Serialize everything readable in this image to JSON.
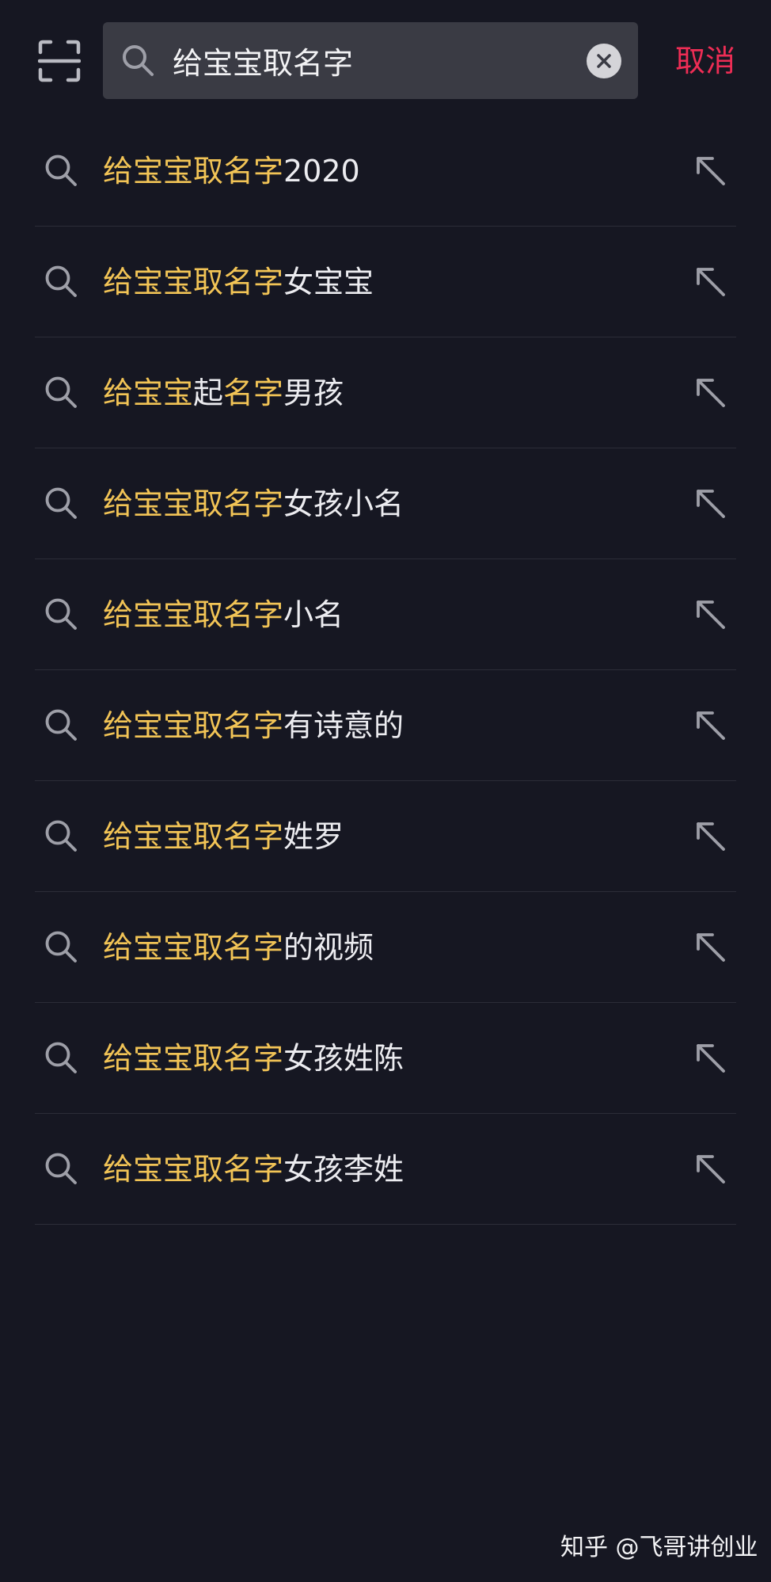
{
  "search": {
    "value": "给宝宝取名字",
    "cancel_label": "取消"
  },
  "icons": {
    "scan": "scan-icon",
    "search": "search-icon",
    "clear": "clear-icon",
    "fill": "arrow-up-left-icon"
  },
  "colors": {
    "background": "#161722",
    "search_box": "#3a3b44",
    "highlight": "#f2c456",
    "cancel": "#ee2d55",
    "divider": "#2c2d38"
  },
  "suggestions": [
    {
      "highlight": "给宝宝取名字",
      "rest": "2020"
    },
    {
      "highlight": "给宝宝取名字",
      "rest": "女宝宝"
    },
    {
      "parts": [
        {
          "text": "给宝宝",
          "hl": true
        },
        {
          "text": "起",
          "hl": false
        },
        {
          "text": "名字",
          "hl": true
        },
        {
          "text": "男孩",
          "hl": false
        }
      ]
    },
    {
      "highlight": "给宝宝取名字",
      "rest": "女孩小名"
    },
    {
      "highlight": "给宝宝取名字",
      "rest": "小名"
    },
    {
      "highlight": "给宝宝取名字",
      "rest": "有诗意的"
    },
    {
      "highlight": "给宝宝取名字",
      "rest": "姓罗"
    },
    {
      "highlight": "给宝宝取名字",
      "rest": "的视频"
    },
    {
      "highlight": "给宝宝取名字",
      "rest": "女孩姓陈"
    },
    {
      "highlight": "给宝宝取名字",
      "rest": "女孩李姓"
    }
  ],
  "watermark": "知乎 @飞哥讲创业"
}
